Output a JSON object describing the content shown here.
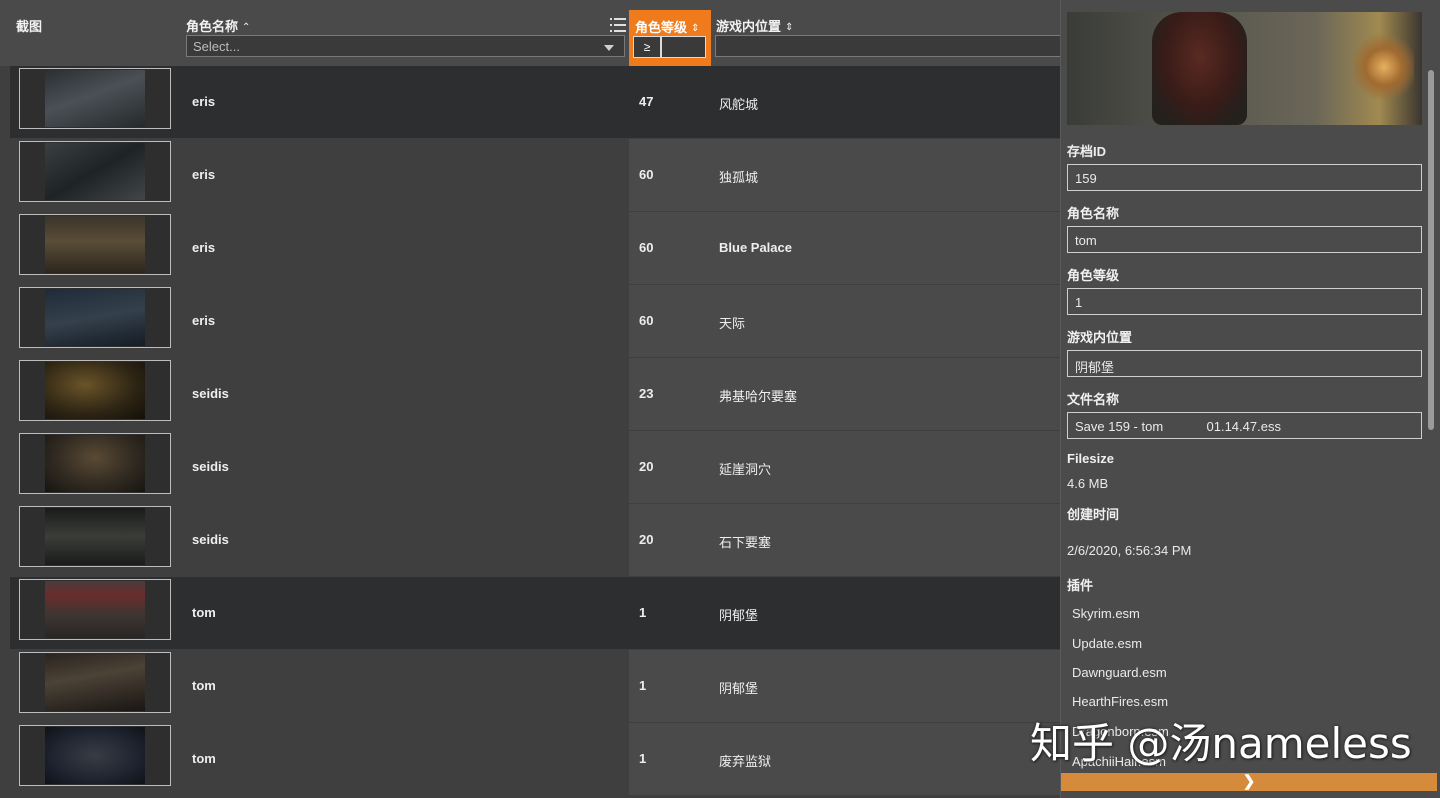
{
  "header": {
    "screenshot_label": "截图",
    "name_label": "角色名称",
    "name_sort_icon": "chevron-up-icon",
    "name_filter_placeholder": "Select...",
    "level_label": "角色等级",
    "level_sort_icon": "sort-updown-icon",
    "level_filter_operator": "≥",
    "location_label": "游戏内位置",
    "location_sort_icon": "sort-updown-icon",
    "accent_color": "#f07b1d"
  },
  "rows": [
    {
      "name": "eris",
      "level": "47",
      "location": "风舵城",
      "selected": true
    },
    {
      "name": "eris",
      "level": "60",
      "location": "独孤城",
      "selected": false
    },
    {
      "name": "eris",
      "level": "60",
      "location": "Blue Palace",
      "selected": false
    },
    {
      "name": "eris",
      "level": "60",
      "location": "天际",
      "selected": false
    },
    {
      "name": "seidis",
      "level": "23",
      "location": "弗基哈尔要塞",
      "selected": false
    },
    {
      "name": "seidis",
      "level": "20",
      "location": "延崖洞穴",
      "selected": false
    },
    {
      "name": "seidis",
      "level": "20",
      "location": "石下要塞",
      "selected": false
    },
    {
      "name": "tom",
      "level": "1",
      "location": "阴郁堡",
      "selected": true
    },
    {
      "name": "tom",
      "level": "1",
      "location": "阴郁堡",
      "selected": false
    },
    {
      "name": "tom",
      "level": "1",
      "location": "废弃监狱",
      "selected": false
    }
  ],
  "detail": {
    "save_id_label": "存档ID",
    "save_id": "159",
    "name_label": "角色名称",
    "name": "tom",
    "level_label": "角色等级",
    "level": "1",
    "location_label": "游戏内位置",
    "location": "阴郁堡",
    "filename_label": "文件名称",
    "filename": "Save 159 - tom            01.14.47.ess",
    "filesize_label": "Filesize",
    "filesize": "4.6 MB",
    "created_label": "创建时间",
    "created": "2/6/2020, 6:56:34 PM",
    "plugins_label": "插件",
    "plugins": [
      "Skyrim.esm",
      "Update.esm",
      "Dawnguard.esm",
      "HearthFires.esm",
      "Dragonborn.esm",
      "ApachiiHair.esm"
    ],
    "next_label": "❯"
  },
  "watermark": "知乎 @汤nameless"
}
